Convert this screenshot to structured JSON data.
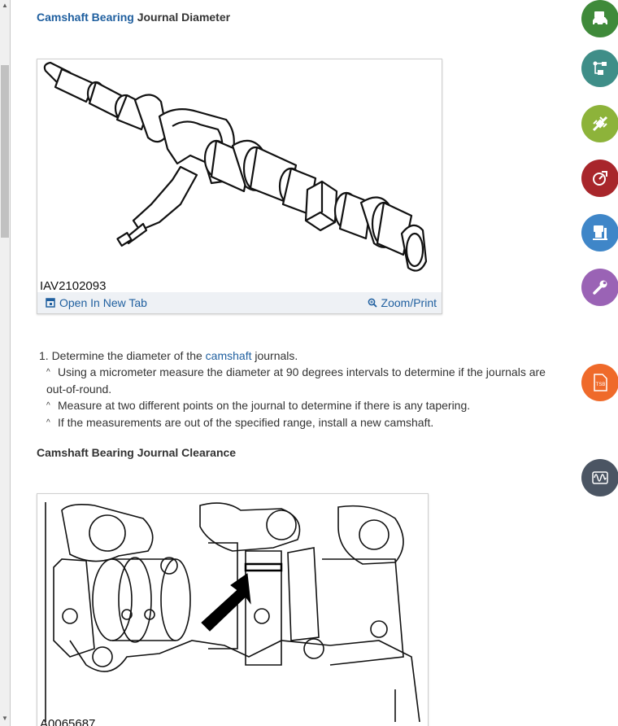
{
  "sections": [
    {
      "title_link": "Camshaft Bearing",
      "title_rest": " Journal Diameter"
    },
    {
      "title": "Camshaft Bearing Journal Clearance"
    }
  ],
  "figure1": {
    "caption": "IAV2102093",
    "open_label": "Open In New Tab",
    "zoom_label": "Zoom/Print"
  },
  "figure2": {
    "caption": "A0065687"
  },
  "steps": {
    "step1_prefix": "1. Determine the diameter of the ",
    "step1_link": "camshaft",
    "step1_suffix": " journals.",
    "sub1": "Using a micrometer measure the diameter at 90 degrees intervals to determine if the journals are out-of-round.",
    "sub2": "Measure at two different points on the journal to determine if there is any tapering.",
    "sub3": "If the measurements are out of the specified range, install a new camshaft.",
    "caret": "^"
  },
  "side_buttons": [
    {
      "icon": "vehicle-info-icon",
      "color": "#3f8a3a"
    },
    {
      "icon": "wiring-diagram-icon",
      "color": "#3f8e88"
    },
    {
      "icon": "components-icon",
      "color": "#8db33a"
    },
    {
      "icon": "diagnostics-icon",
      "color": "#a8262b"
    },
    {
      "icon": "repair-lift-icon",
      "color": "#3f86c8"
    },
    {
      "icon": "tools-wrench-icon",
      "color": "#9a63b5"
    },
    {
      "icon": "tsb-icon",
      "color": "#ef6a2a",
      "label": "TSB"
    },
    {
      "icon": "waveform-icon",
      "color": "#4b5563"
    }
  ]
}
